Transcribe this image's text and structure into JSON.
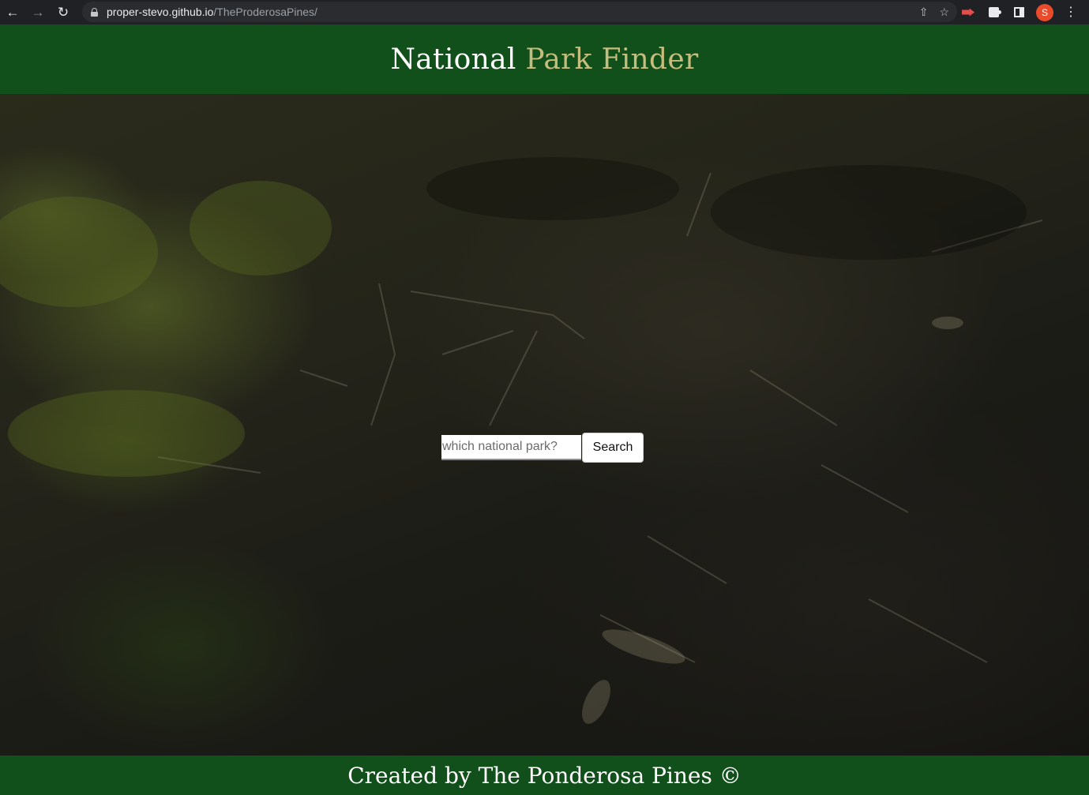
{
  "browser": {
    "url_host": "proper-stevo.github.io",
    "url_path": "/TheProderosaPines/",
    "profile_initial": "S"
  },
  "header": {
    "title_part1": "National",
    "title_part2": "Park Finder"
  },
  "search": {
    "placeholder": "which national park?",
    "button_label": "Search"
  },
  "footer": {
    "text": "Created by The Ponderosa Pines ©"
  },
  "colors": {
    "header_bg": "#12501b",
    "title_accent": "#c5bc7e"
  }
}
